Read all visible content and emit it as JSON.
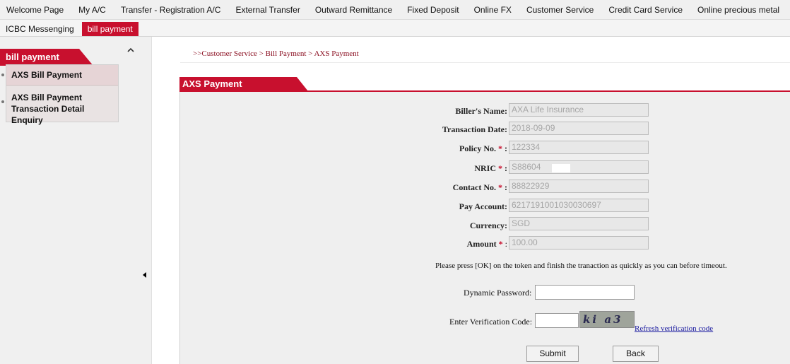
{
  "top_nav": [
    "Welcome Page",
    "My A/C",
    "Transfer - Registration A/C",
    "External Transfer",
    "Outward Remittance",
    "Fixed Deposit",
    "Online FX",
    "Customer Service",
    "Credit Card Service",
    "Online precious metal"
  ],
  "sub_nav": {
    "messaging": "ICBC Messenging",
    "active": "bill payment"
  },
  "sidebar": {
    "header": "bill payment",
    "items": [
      "AXS Bill Payment",
      "AXS Bill Payment",
      "Transaction Detail Enquiry"
    ]
  },
  "breadcrumb": ">>Customer Service > Bill Payment > AXS Payment",
  "panel_title": "AXS Payment",
  "form": {
    "billers_name_label": "Biller's Name:",
    "billers_name": "AXA Life Insurance",
    "transaction_date_label": "Transaction Date:",
    "transaction_date": "2018-09-09",
    "policy_no_label": "Policy No.",
    "policy_no": "122334",
    "nric_label": "NRIC",
    "nric": "S88604",
    "contact_no_label": "Contact No.",
    "contact_no": "88822929",
    "pay_account_label": "Pay Account:",
    "pay_account": "6217191001030030697",
    "currency_label": "Currency:",
    "currency": "SGD",
    "amount_label": "Amount",
    "amount": "100.00",
    "required_mark": "*",
    "colon": ":"
  },
  "notice": "Please press [OK] on the token and finish the tranaction as quickly as you can before timeout.",
  "dynamic_password_label": "Dynamic Password:",
  "dynamic_password_value": "",
  "verification_label": "Enter Verification Code:",
  "verification_value": "",
  "captcha_text": "ki a3",
  "refresh_link": "Refresh verification code",
  "buttons": {
    "submit": "Submit",
    "back": "Back"
  },
  "colors": {
    "accent": "#c8102e",
    "link": "#1a1aa0"
  },
  "icons": {
    "collapse": "chevron-up-icon",
    "expand": "caret-left-icon"
  }
}
